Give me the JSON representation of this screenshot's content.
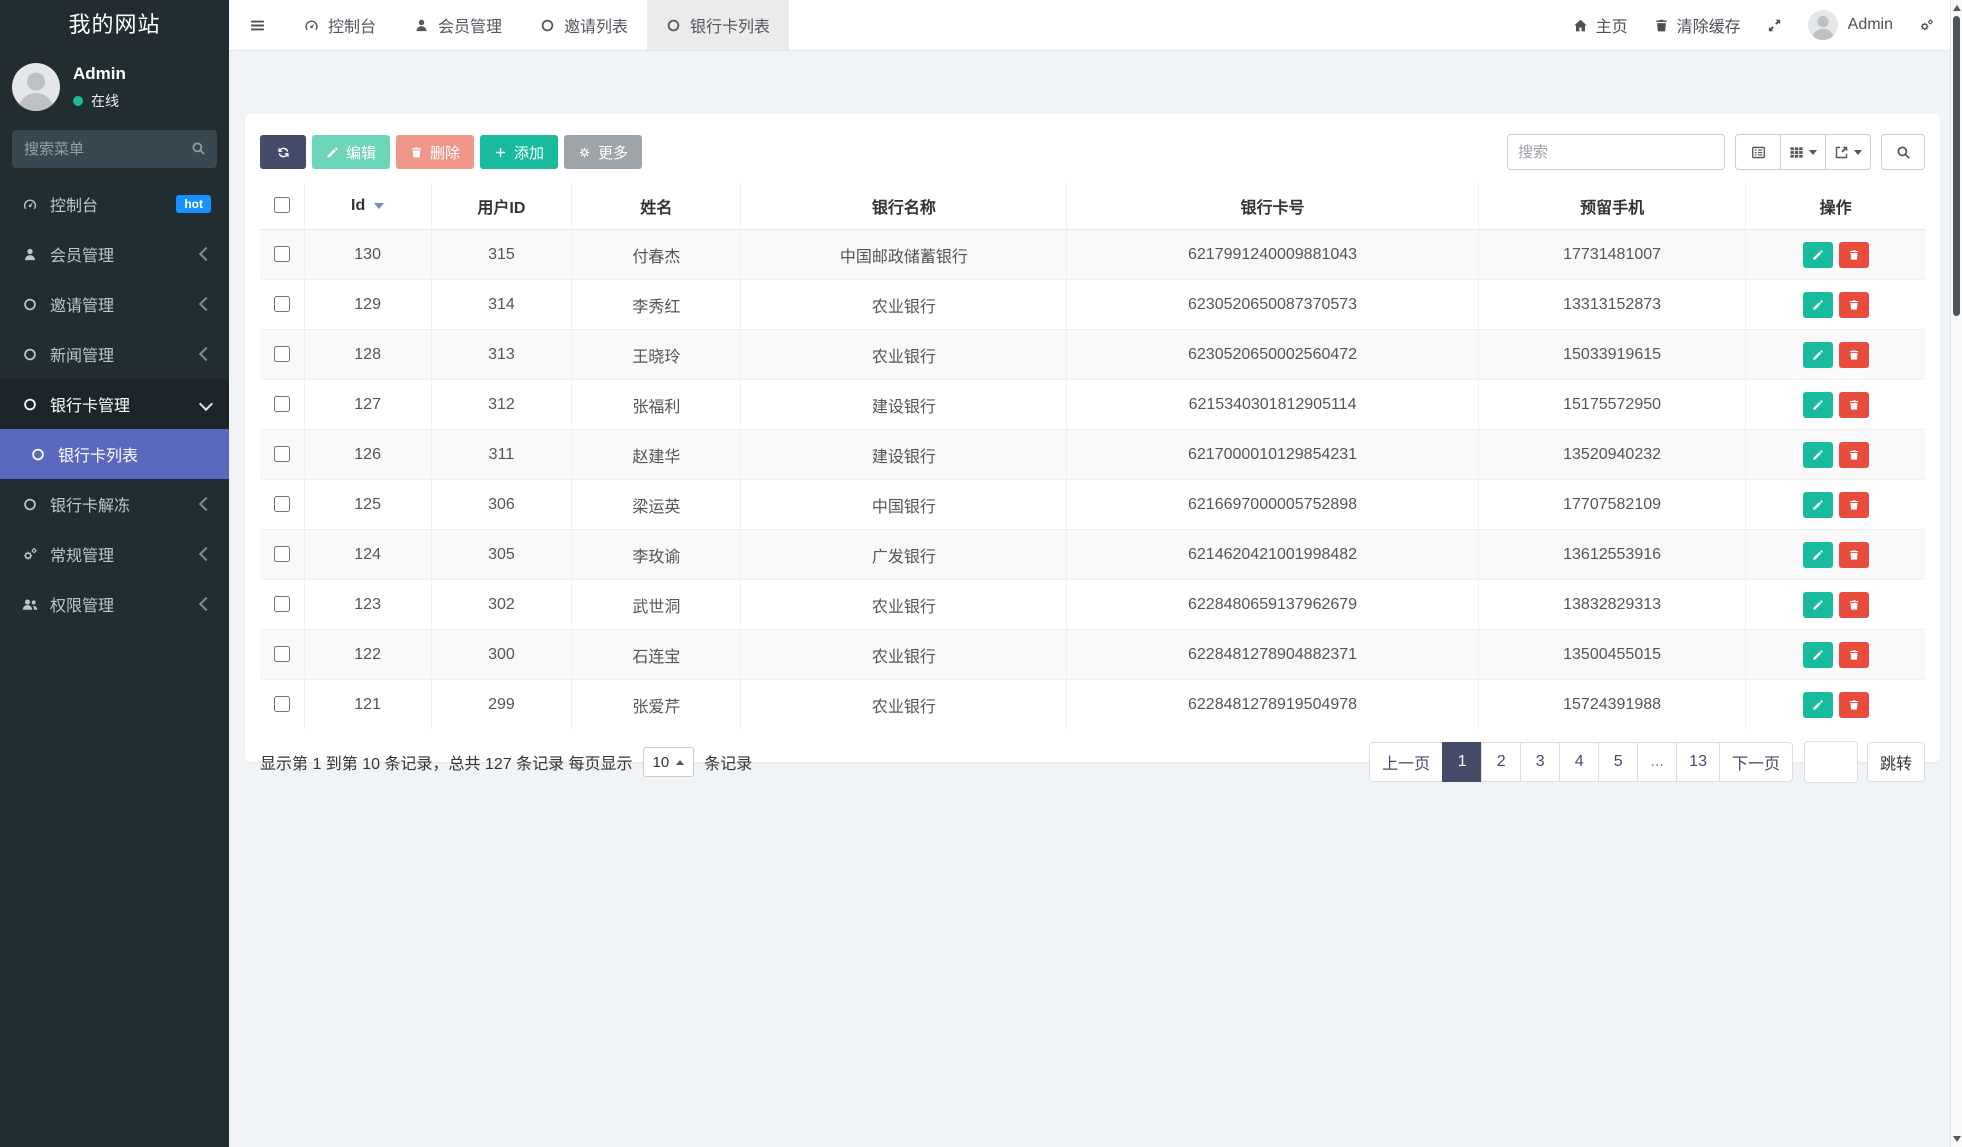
{
  "app": {
    "title": "我的网站"
  },
  "sidebar": {
    "user": {
      "name": "Admin",
      "status": "在线"
    },
    "search_placeholder": "搜索菜单",
    "menu": [
      {
        "key": "console",
        "label": "控制台",
        "icon": "dashboard-icon",
        "badge": "hot"
      },
      {
        "key": "members",
        "label": "会员管理",
        "icon": "user-icon",
        "chevron": "left"
      },
      {
        "key": "invites",
        "label": "邀请管理",
        "icon": "circle-icon",
        "chevron": "left"
      },
      {
        "key": "news",
        "label": "新闻管理",
        "icon": "circle-icon",
        "chevron": "left"
      },
      {
        "key": "bankcard",
        "label": "银行卡管理",
        "icon": "circle-icon",
        "chevron": "down",
        "expanded": true
      },
      {
        "key": "bankcard-list",
        "label": "银行卡列表",
        "icon": "circle-icon",
        "active": true,
        "submenu": true
      },
      {
        "key": "bankcard-unfreeze",
        "label": "银行卡解冻",
        "icon": "circle-icon",
        "chevron": "left"
      },
      {
        "key": "general",
        "label": "常规管理",
        "icon": "cogs-icon",
        "chevron": "left"
      },
      {
        "key": "permissions",
        "label": "权限管理",
        "icon": "users-icon",
        "chevron": "left"
      }
    ]
  },
  "topnav": {
    "tabs": [
      {
        "key": "console",
        "label": "控制台",
        "icon": "dashboard-icon"
      },
      {
        "key": "members",
        "label": "会员管理",
        "icon": "user-icon"
      },
      {
        "key": "invite-list",
        "label": "邀请列表",
        "icon": "circle-icon"
      },
      {
        "key": "bankcard-list",
        "label": "银行卡列表",
        "icon": "circle-icon",
        "active": true
      }
    ],
    "home": "主页",
    "clear_cache": "清除缓存",
    "user": "Admin"
  },
  "toolbar": {
    "edit": "编辑",
    "delete": "删除",
    "add": "添加",
    "more": "更多",
    "search_placeholder": "搜索"
  },
  "table": {
    "columns": [
      "Id",
      "用户ID",
      "姓名",
      "银行名称",
      "银行卡号",
      "预留手机",
      "操作"
    ],
    "sorted_column": "Id",
    "rows": [
      {
        "id": "130",
        "user_id": "315",
        "name": "付春杰",
        "bank": "中国邮政储蓄银行",
        "card": "6217991240009881043",
        "phone": "17731481007"
      },
      {
        "id": "129",
        "user_id": "314",
        "name": "李秀红",
        "bank": "农业银行",
        "card": "6230520650087370573",
        "phone": "13313152873"
      },
      {
        "id": "128",
        "user_id": "313",
        "name": "王晓玲",
        "bank": "农业银行",
        "card": "6230520650002560472",
        "phone": "15033919615"
      },
      {
        "id": "127",
        "user_id": "312",
        "name": "张福利",
        "bank": "建设银行",
        "card": "6215340301812905114",
        "phone": "15175572950"
      },
      {
        "id": "126",
        "user_id": "311",
        "name": "赵建华",
        "bank": "建设银行",
        "card": "6217000010129854231",
        "phone": "13520940232"
      },
      {
        "id": "125",
        "user_id": "306",
        "name": "梁运英",
        "bank": "中国银行",
        "card": "6216697000005752898",
        "phone": "17707582109"
      },
      {
        "id": "124",
        "user_id": "305",
        "name": "李玫谕",
        "bank": "广发银行",
        "card": "6214620421001998482",
        "phone": "13612553916"
      },
      {
        "id": "123",
        "user_id": "302",
        "name": "武世洞",
        "bank": "农业银行",
        "card": "6228480659137962679",
        "phone": "13832829313"
      },
      {
        "id": "122",
        "user_id": "300",
        "name": "石连宝",
        "bank": "农业银行",
        "card": "6228481278904882371",
        "phone": "13500455015"
      },
      {
        "id": "121",
        "user_id": "299",
        "name": "张爱芹",
        "bank": "农业银行",
        "card": "6228481278919504978",
        "phone": "15724391988"
      }
    ]
  },
  "footer": {
    "summary_prefix": "显示第 1 到第 10 条记录，总共 127 条记录 每页显示",
    "page_size": "10",
    "summary_suffix": "条记录",
    "pagination": {
      "prev": "上一页",
      "pages": [
        "1",
        "2",
        "3",
        "4",
        "5",
        "...",
        "13"
      ],
      "active_page": "1",
      "next": "下一页",
      "jump": "跳转"
    }
  },
  "colors": {
    "sidebar_bg": "#222d32",
    "active_menu": "#5a68c0",
    "hot_badge": "#1890ff",
    "primary_dark": "#444c69",
    "success": "#18bc9c",
    "danger": "#e74c3c",
    "online_dot": "#1abc9c",
    "content_bg": "#f1f4f6"
  }
}
